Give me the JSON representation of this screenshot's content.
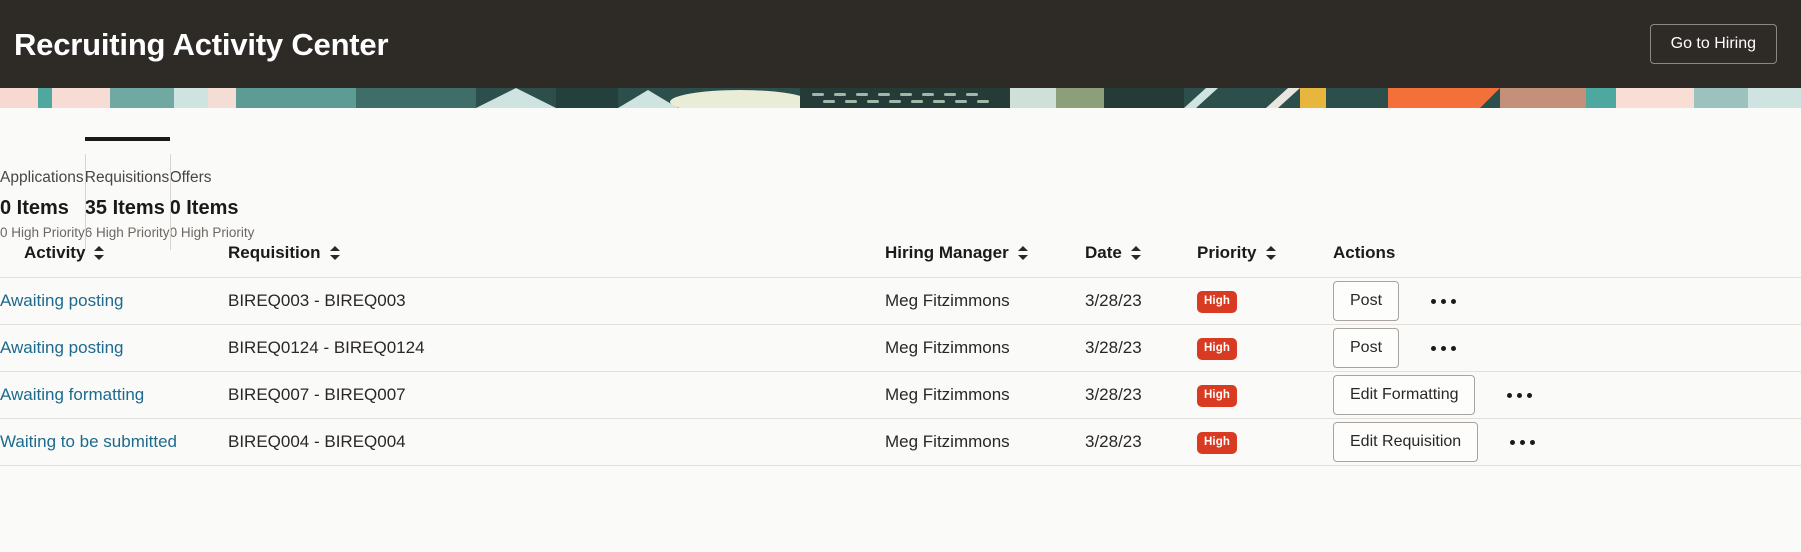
{
  "header": {
    "title": "Recruiting Activity Center",
    "go_to_hiring_label": "Go to Hiring",
    "background_color": "#2e2a26"
  },
  "stats": {
    "tabs": [
      {
        "name": "Applications",
        "count": "0 Items",
        "sub": "0 High Priority",
        "active": false
      },
      {
        "name": "Requisitions",
        "count": "35 Items",
        "sub": "6 High Priority",
        "active": true
      },
      {
        "name": "Offers",
        "count": "0 Items",
        "sub": "0 High Priority",
        "active": false
      }
    ]
  },
  "table": {
    "columns": [
      {
        "label": "Activity",
        "sortable": true
      },
      {
        "label": "Requisition",
        "sortable": true
      },
      {
        "label": "Hiring Manager",
        "sortable": true
      },
      {
        "label": "Date",
        "sortable": true
      },
      {
        "label": "Priority",
        "sortable": true
      },
      {
        "label": "Actions",
        "sortable": false
      }
    ],
    "rows": [
      {
        "activity": "Awaiting posting",
        "requisition": "BIREQ003 - BIREQ003",
        "hiring_manager": "Meg Fitzimmons",
        "date": "3/28/23",
        "priority": "High",
        "action_label": "Post",
        "overflow_label": "More actions"
      },
      {
        "activity": "Awaiting posting",
        "requisition": "BIREQ0124 - BIREQ0124",
        "hiring_manager": "Meg Fitzimmons",
        "date": "3/28/23",
        "priority": "High",
        "action_label": "Post",
        "overflow_label": "More actions"
      },
      {
        "activity": "Awaiting formatting",
        "requisition": "BIREQ007 - BIREQ007",
        "hiring_manager": "Meg Fitzimmons",
        "date": "3/28/23",
        "priority": "High",
        "action_label": "Edit Formatting",
        "overflow_label": "More actions"
      },
      {
        "activity": "Waiting to be submitted",
        "requisition": "BIREQ004 - BIREQ004",
        "hiring_manager": "Meg Fitzimmons",
        "date": "3/28/23",
        "priority": "High",
        "action_label": "Edit Requisition",
        "overflow_label": "More actions"
      }
    ]
  },
  "colors": {
    "link": "#1d6a8c",
    "priority_high": "#d93a22",
    "header_bg": "#2e2a26",
    "page_bg": "#fafaf9",
    "active_tab_rule": "#1a1a1a"
  }
}
